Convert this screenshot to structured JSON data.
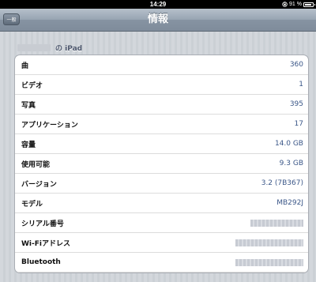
{
  "status_bar": {
    "time": "14:29",
    "battery": "91 %",
    "battery_level": 0.91
  },
  "nav": {
    "title": "情報",
    "back_label": "一般"
  },
  "section": {
    "device_suffix": "の iPad"
  },
  "rows": [
    {
      "label": "曲",
      "value": "360"
    },
    {
      "label": "ビデオ",
      "value": "1"
    },
    {
      "label": "写真",
      "value": "395"
    },
    {
      "label": "アプリケーション",
      "value": "17"
    },
    {
      "label": "容量",
      "value": "14.0 GB"
    },
    {
      "label": "使用可能",
      "value": "9.3 GB"
    },
    {
      "label": "バージョン",
      "value": "3.2 (7B367)"
    },
    {
      "label": "モデル",
      "value": "MB292J"
    },
    {
      "label": "シリアル番号",
      "value": ""
    },
    {
      "label": "Wi-Fiアドレス",
      "value": ""
    },
    {
      "label": "Bluetooth",
      "value": ""
    }
  ]
}
